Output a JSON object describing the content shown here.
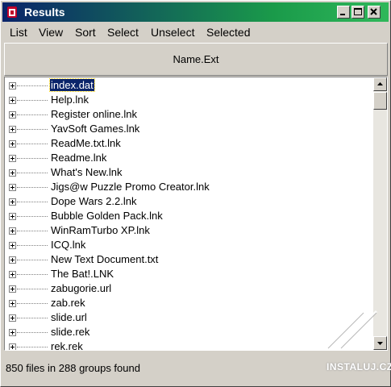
{
  "window": {
    "title": "Results"
  },
  "menu": [
    "List",
    "View",
    "Sort",
    "Select",
    "Unselect",
    "Selected"
  ],
  "column_header": "Name.Ext",
  "rows": [
    "index.dat",
    "Help.lnk",
    "Register online.lnk",
    "YavSoft Games.lnk",
    "ReadMe.txt.lnk",
    "Readme.lnk",
    "What's New.lnk",
    "Jigs@w Puzzle Promo Creator.lnk",
    "Dope Wars 2.2.lnk",
    "Bubble Golden Pack.lnk",
    "WinRamTurbo XP.lnk",
    "ICQ.lnk",
    "New Text Document.txt",
    "The Bat!.LNK",
    "zabugorie.url",
    "zab.rek",
    "slide.url",
    "slide.rek",
    "rek.rek"
  ],
  "selected_row": 0,
  "status": "850 files in 288 groups found",
  "watermark": "INSTALUJ.CZ",
  "colors": {
    "title_start": "#0a246a",
    "title_end": "#2fb85a",
    "selection": "#0a246a"
  }
}
